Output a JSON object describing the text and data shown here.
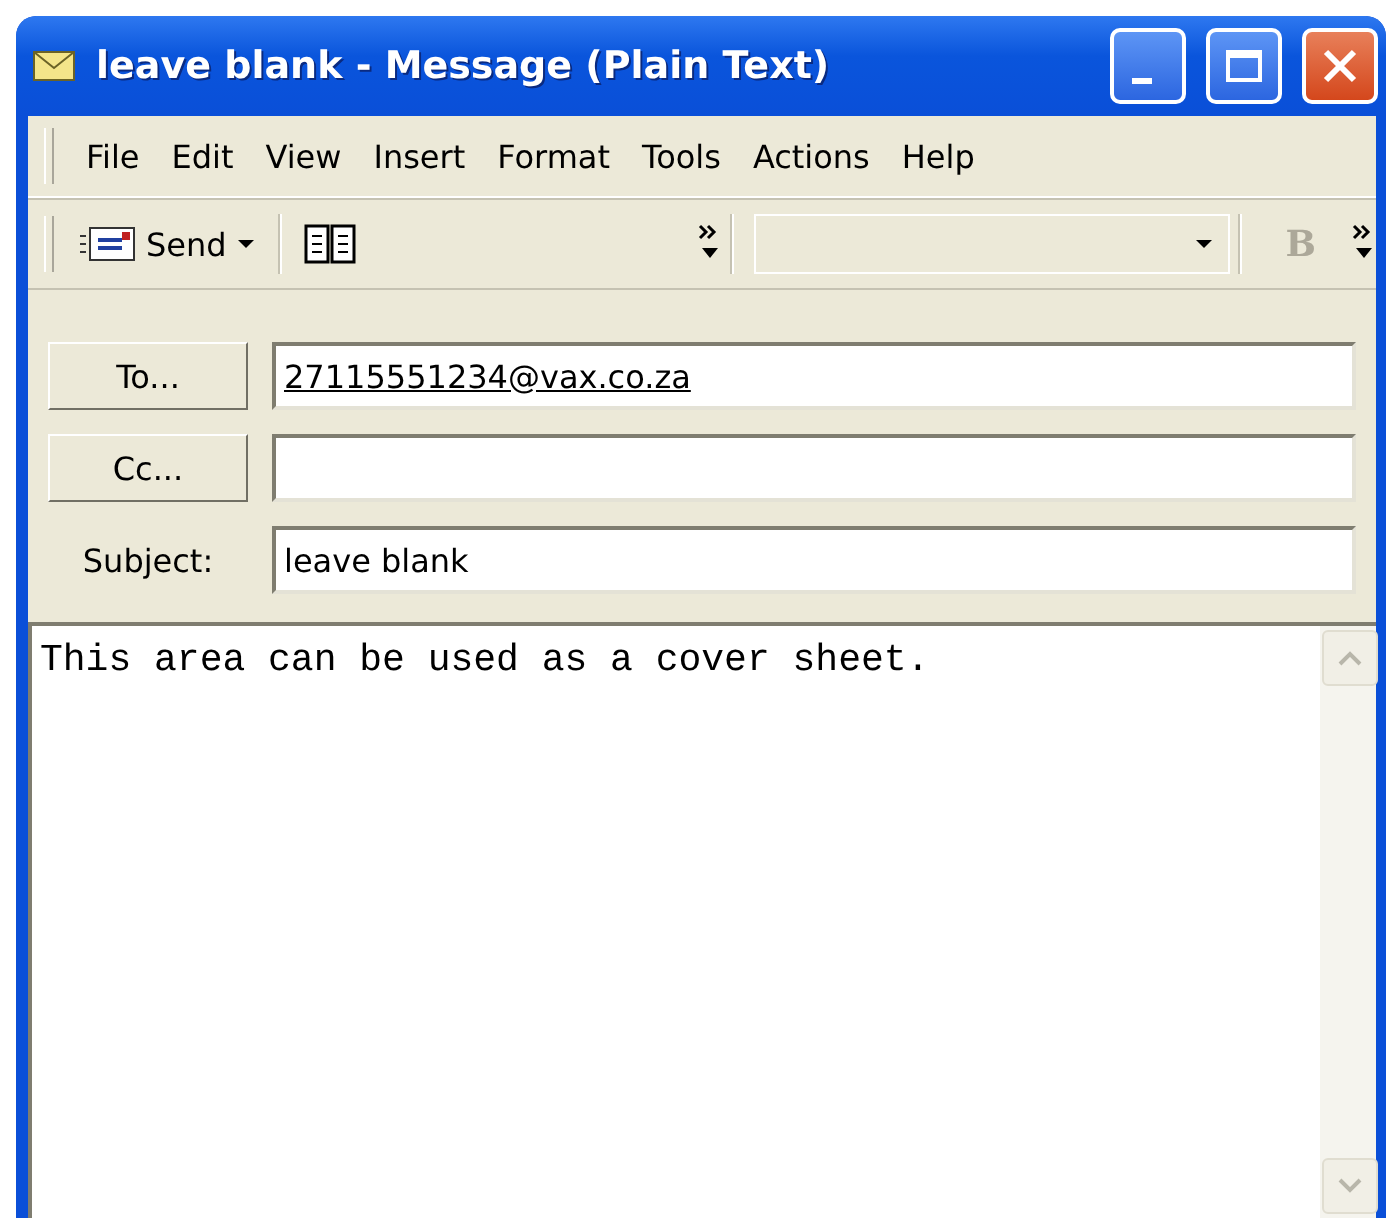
{
  "window": {
    "title": "leave blank - Message (Plain Text)"
  },
  "menu": [
    "File",
    "Edit",
    "View",
    "Insert",
    "Format",
    "Tools",
    "Actions",
    "Help"
  ],
  "toolbar": {
    "send": {
      "label": "Send"
    },
    "bold": {
      "label": "B",
      "disabled": true
    }
  },
  "fields": [
    {
      "kind": "button",
      "label": "To...",
      "value": "27115551234@vax.co.za",
      "resolved": true
    },
    {
      "kind": "button",
      "label": "Cc..."
    },
    {
      "kind": "label",
      "label": "Subject:",
      "value": "leave blank"
    }
  ],
  "body": {
    "text": "This area can be used as a cover sheet."
  }
}
